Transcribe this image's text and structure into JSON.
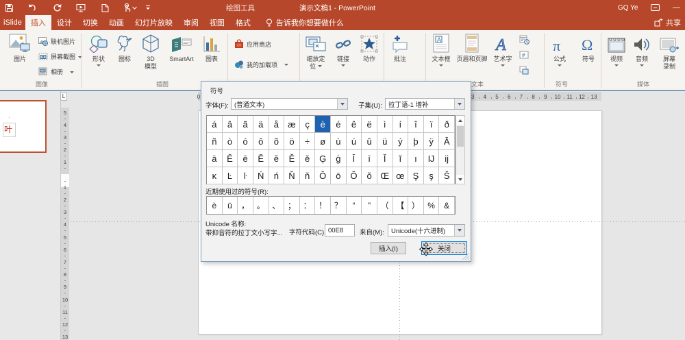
{
  "titlebar": {
    "context_label": "绘图工具",
    "title": "演示文稿1 - PowerPoint",
    "user": "GQ Ye",
    "minimize_glyph": "—"
  },
  "tabs": {
    "items": [
      {
        "label": "iSlide",
        "active": false
      },
      {
        "label": "插入",
        "active": true
      },
      {
        "label": "设计",
        "active": false
      },
      {
        "label": "切换",
        "active": false
      },
      {
        "label": "动画",
        "active": false
      },
      {
        "label": "幻灯片放映",
        "active": false
      },
      {
        "label": "审阅",
        "active": false
      },
      {
        "label": "视图",
        "active": false
      },
      {
        "label": "格式",
        "active": false
      }
    ],
    "tellme": "告诉我你想要做什么",
    "share": "共享"
  },
  "ribbon": {
    "images": {
      "label": "图像",
      "picture": "图片",
      "online_pictures": "联机图片",
      "screenshot": "屏幕截图",
      "photo_album": "相册"
    },
    "illustrations": {
      "label": "插图",
      "shapes": "形状",
      "icons": "图标",
      "models_line1": "3D",
      "models_line2": "模型",
      "smartart": "SmartArt",
      "chart": "图表"
    },
    "addins": {
      "store": "应用商店",
      "my_addins": "我的加载项"
    },
    "links": {
      "zoom_line1": "缩放定",
      "zoom_line2": "位",
      "link": "链接",
      "action": "动作"
    },
    "comments": {
      "comment": "批注"
    },
    "text": {
      "label": "文本",
      "textbox": "文本框",
      "header_footer": "页眉和页脚",
      "wordart": "艺术字"
    },
    "symbols": {
      "label": "符号",
      "equation": "公式",
      "symbol": "符号"
    },
    "media": {
      "label": "媒体",
      "video": "视频",
      "audio": "音频",
      "screen_rec_line1": "屏幕",
      "screen_rec_line2": "录制"
    }
  },
  "thumbnails": {
    "slide_text": "叶",
    "mark": "'"
  },
  "rulers": {
    "h_numbers": [
      "3",
      "4",
      "5",
      "6",
      "7",
      "8",
      "9",
      "10",
      "11",
      "12",
      "13"
    ],
    "h_zero": "0",
    "v_above": [
      "5",
      "4",
      "3",
      "2",
      "1"
    ],
    "v_below": [
      "1",
      "2",
      "3",
      "4",
      "5",
      "6",
      "7",
      "8",
      "9",
      "10",
      "11",
      "12",
      "13"
    ],
    "tab_selector": "L"
  },
  "dialog": {
    "title": "符号",
    "font_label": "字体(F):",
    "font_value": "(普通文本)",
    "subset_label": "子集(U):",
    "subset_value": "拉丁语-1 增补",
    "grid": {
      "rows": [
        [
          "á",
          "â",
          "ã",
          "ä",
          "å",
          "æ",
          "ç",
          "è",
          "é",
          "ê",
          "ë",
          "ì",
          "í",
          "î",
          "ï",
          "ð"
        ],
        [
          "ñ",
          "ò",
          "ó",
          "ô",
          "õ",
          "ö",
          "÷",
          "ø",
          "ù",
          "ú",
          "û",
          "ü",
          "ý",
          "þ",
          "ÿ",
          "Ā"
        ],
        [
          "ā",
          "Ē",
          "ē",
          "Ĕ",
          "ĕ",
          "Ě",
          "ě",
          "Ģ",
          "ģ",
          "Ī",
          "ī",
          "Ĭ",
          "ĭ",
          "ı",
          "Ĳ",
          "ĳ"
        ],
        [
          "ĸ",
          "Ŀ",
          "ŀ",
          "Ń",
          "ń",
          "Ň",
          "ň",
          "Ō",
          "ō",
          "Ŏ",
          "ŏ",
          "Œ",
          "œ",
          "Ş",
          "ş",
          "Š"
        ]
      ],
      "selected": {
        "row": 0,
        "col": 7,
        "char": "è"
      }
    },
    "recent_label": "近期使用过的符号(R):",
    "recent": [
      "è",
      "ū",
      "，",
      "。",
      "、",
      "；",
      "：",
      "！",
      "？",
      "“",
      "”",
      "（",
      "【",
      "）",
      "%",
      "&"
    ],
    "unicode_name_label": "Unicode 名称:",
    "unicode_name_value": "带抑音符的拉丁文小写字...",
    "char_code_label": "字符代码(C):",
    "char_code_value": "00E8",
    "from_label": "来自(M):",
    "from_value": "Unicode(十六进制)",
    "insert_button": "插入(I)",
    "close_button": "关闭"
  }
}
